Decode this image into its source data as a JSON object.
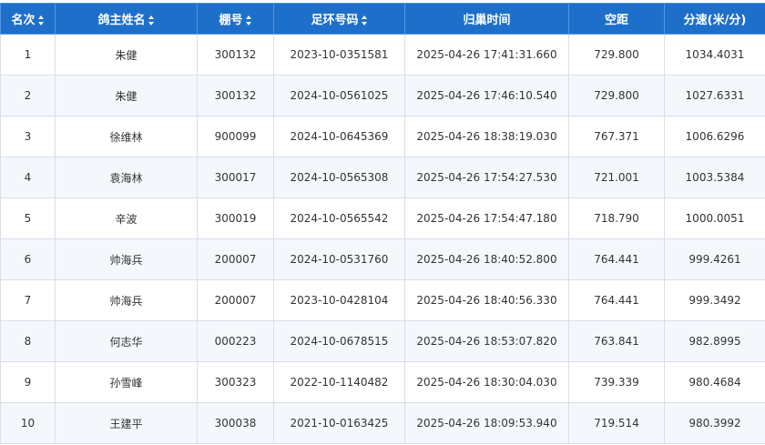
{
  "table": {
    "headers": {
      "rank": "名次",
      "owner": "鸽主姓名",
      "loft": "棚号",
      "ring": "足环号码",
      "time": "归巢时间",
      "distance": "空距",
      "speed": "分速(米/分)"
    },
    "rows": [
      {
        "rank": "1",
        "owner": "朱健",
        "loft": "300132",
        "ring": "2023-10-0351581",
        "time": "2025-04-26 17:41:31.660",
        "distance": "729.800",
        "speed": "1034.4031"
      },
      {
        "rank": "2",
        "owner": "朱健",
        "loft": "300132",
        "ring": "2024-10-0561025",
        "time": "2025-04-26 17:46:10.540",
        "distance": "729.800",
        "speed": "1027.6331"
      },
      {
        "rank": "3",
        "owner": "徐维林",
        "loft": "900099",
        "ring": "2024-10-0645369",
        "time": "2025-04-26 18:38:19.030",
        "distance": "767.371",
        "speed": "1006.6296"
      },
      {
        "rank": "4",
        "owner": "袁海林",
        "loft": "300017",
        "ring": "2024-10-0565308",
        "time": "2025-04-26 17:54:27.530",
        "distance": "721.001",
        "speed": "1003.5384"
      },
      {
        "rank": "5",
        "owner": "辛波",
        "loft": "300019",
        "ring": "2024-10-0565542",
        "time": "2025-04-26 17:54:47.180",
        "distance": "718.790",
        "speed": "1000.0051"
      },
      {
        "rank": "6",
        "owner": "帅海兵",
        "loft": "200007",
        "ring": "2024-10-0531760",
        "time": "2025-04-26 18:40:52.800",
        "distance": "764.441",
        "speed": "999.4261"
      },
      {
        "rank": "7",
        "owner": "帅海兵",
        "loft": "200007",
        "ring": "2023-10-0428104",
        "time": "2025-04-26 18:40:56.330",
        "distance": "764.441",
        "speed": "999.3492"
      },
      {
        "rank": "8",
        "owner": "何志华",
        "loft": "000223",
        "ring": "2024-10-0678515",
        "time": "2025-04-26 18:53:07.820",
        "distance": "763.841",
        "speed": "982.8995"
      },
      {
        "rank": "9",
        "owner": "孙雪峰",
        "loft": "300323",
        "ring": "2022-10-1140482",
        "time": "2025-04-26 18:30:04.030",
        "distance": "739.339",
        "speed": "980.4684"
      },
      {
        "rank": "10",
        "owner": "王建平",
        "loft": "300038",
        "ring": "2021-10-0163425",
        "time": "2025-04-26 18:09:53.940",
        "distance": "719.514",
        "speed": "980.3992"
      }
    ]
  }
}
